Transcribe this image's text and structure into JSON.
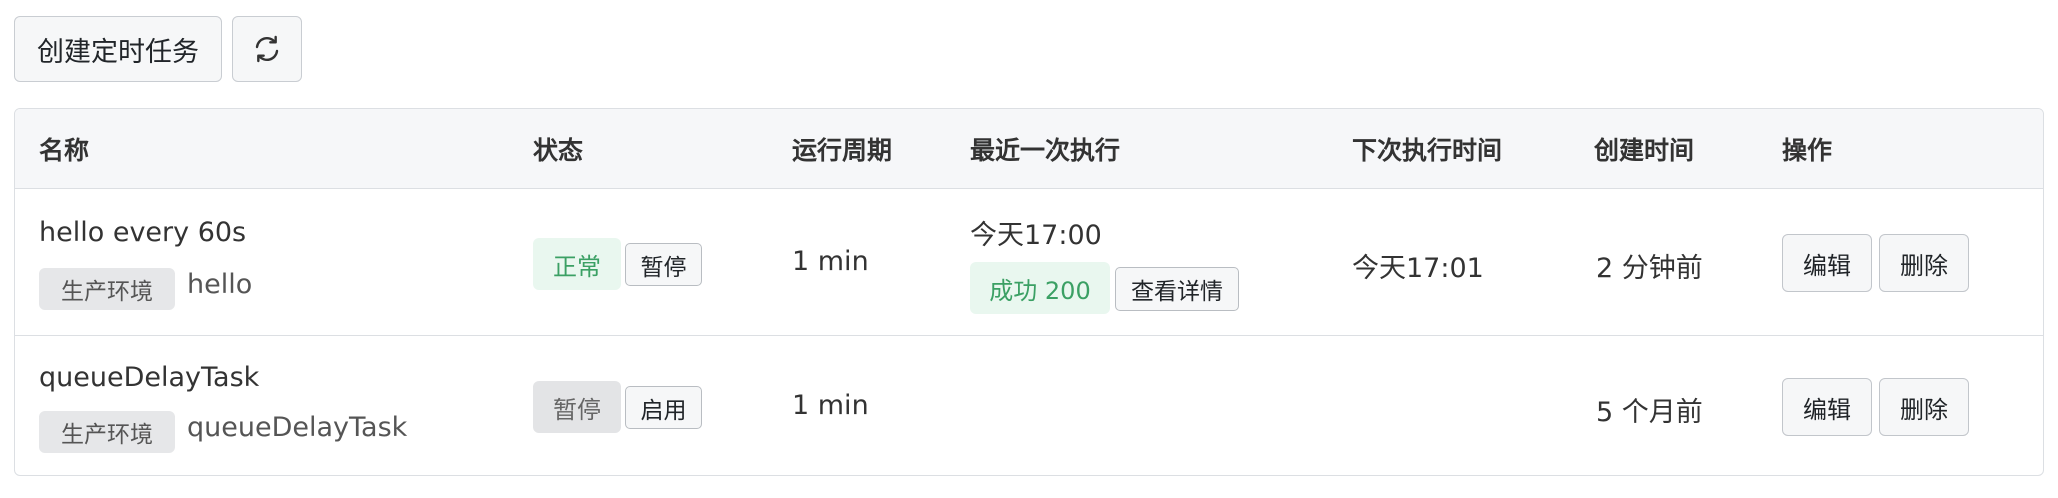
{
  "toolbar": {
    "create_label": "创建定时任务",
    "refresh_icon": "refresh-icon"
  },
  "table": {
    "headers": {
      "name": "名称",
      "status": "状态",
      "period": "运行周期",
      "last_run": "最近一次执行",
      "next_run": "下次执行时间",
      "created": "创建时间",
      "actions": "操作"
    },
    "rows": [
      {
        "name": "hello every 60s",
        "env": "生产环境",
        "task": "hello",
        "status": "正常",
        "status_action": "暂停",
        "period": "1 min",
        "last_run_time": "今天17:00",
        "last_run_result": "成功 200",
        "last_run_detail": "查看详情",
        "next_run": "今天17:01",
        "created": "2 分钟前",
        "edit": "编辑",
        "delete": "删除"
      },
      {
        "name": "queueDelayTask",
        "env": "生产环境",
        "task": "queueDelayTask",
        "status": "暂停",
        "status_action": "启用",
        "period": "1 min",
        "created": "5 个月前",
        "edit": "编辑",
        "delete": "删除"
      }
    ]
  },
  "colors": {
    "success_text": "#3ba064",
    "success_bg": "#e9f7ef",
    "header_bg": "#f6f7f9",
    "border": "#dcdfe3"
  }
}
